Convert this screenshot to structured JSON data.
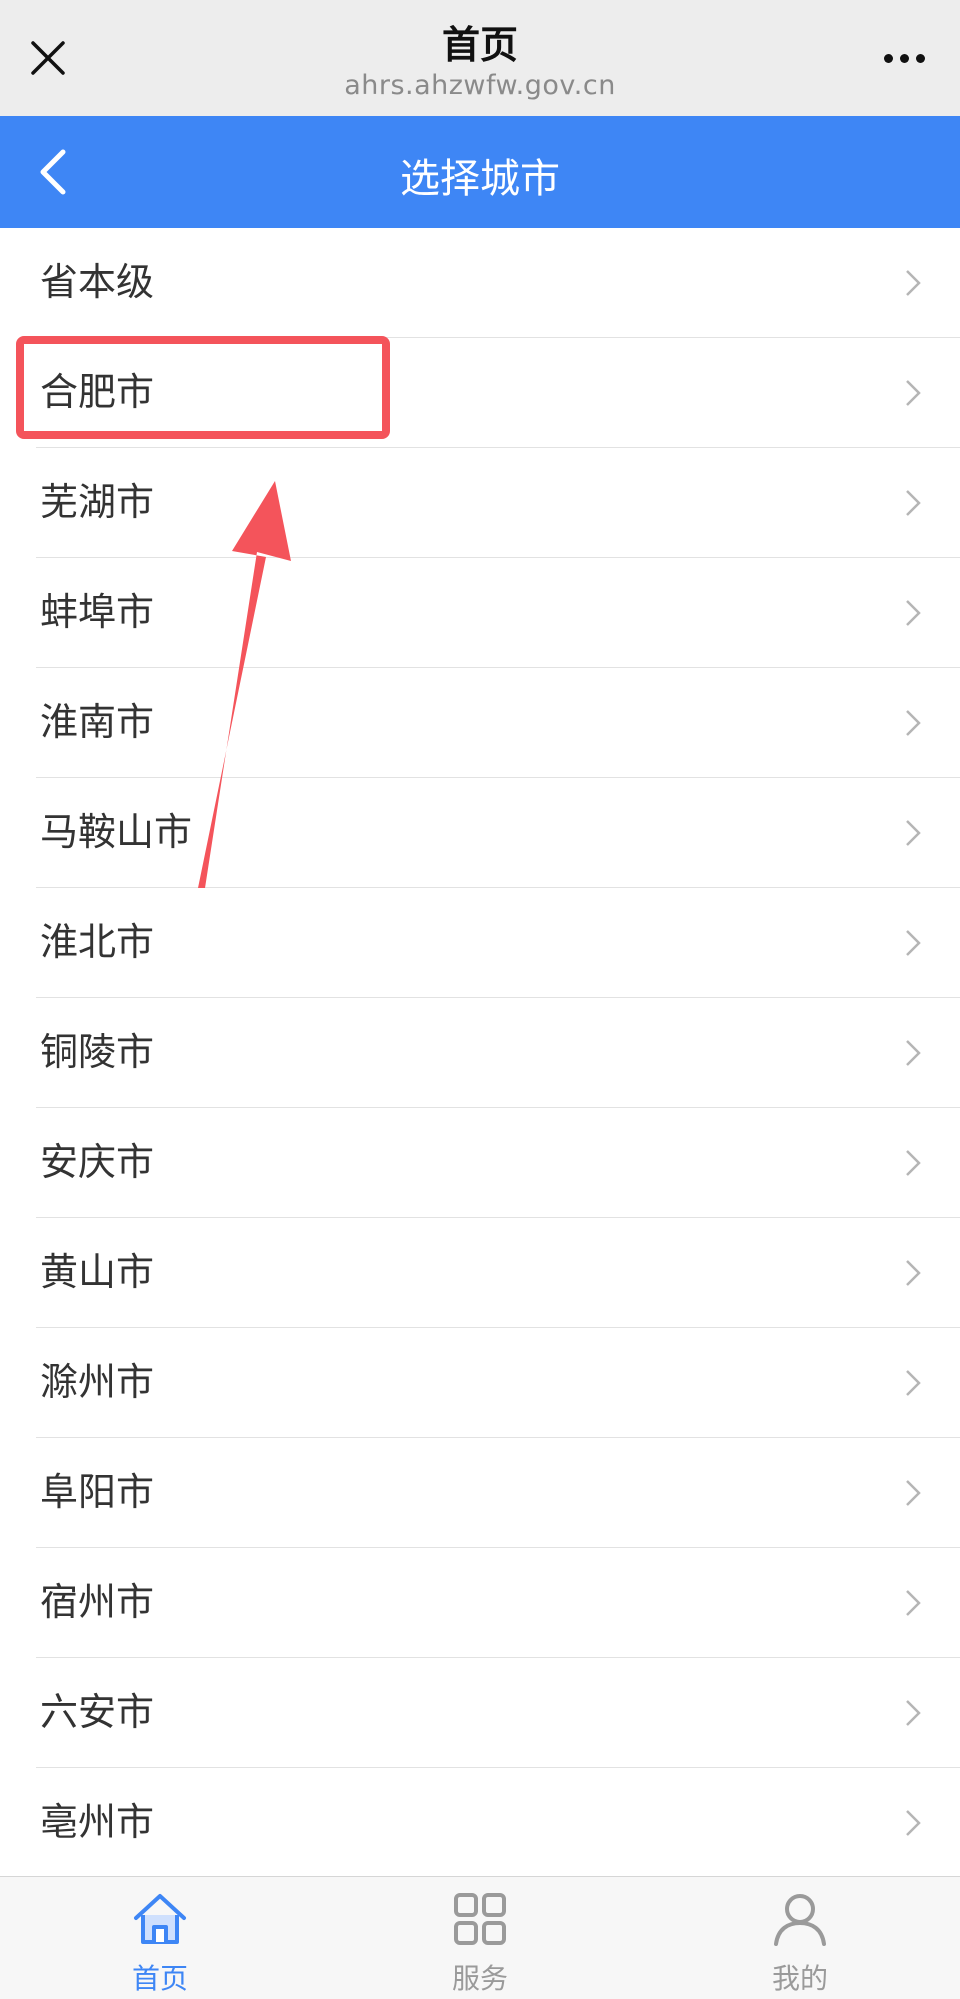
{
  "topbar": {
    "title": "首页",
    "url": "ahrs.ahzwfw.gov.cn",
    "close_icon": "close-icon",
    "more_icon": "more-icon"
  },
  "header": {
    "title": "选择城市",
    "back_icon": "back-arrow-icon",
    "color": "#3e86f5"
  },
  "cities": [
    {
      "name": "省本级"
    },
    {
      "name": "合肥市"
    },
    {
      "name": "芜湖市"
    },
    {
      "name": "蚌埠市"
    },
    {
      "name": "淮南市"
    },
    {
      "name": "马鞍山市"
    },
    {
      "name": "淮北市"
    },
    {
      "name": "铜陵市"
    },
    {
      "name": "安庆市"
    },
    {
      "name": "黄山市"
    },
    {
      "name": "滁州市"
    },
    {
      "name": "阜阳市"
    },
    {
      "name": "宿州市"
    },
    {
      "name": "六安市"
    },
    {
      "name": "亳州市"
    }
  ],
  "annotation": {
    "highlighted_city": "合肥市",
    "color": "#f4545b"
  },
  "tabbar": {
    "tabs": [
      {
        "label": "首页",
        "icon": "home-icon",
        "active": true
      },
      {
        "label": "服务",
        "icon": "grid-icon",
        "active": false
      },
      {
        "label": "我的",
        "icon": "user-icon",
        "active": false
      }
    ],
    "active_color": "#3e86f5",
    "inactive_color": "#9a9a9a"
  }
}
